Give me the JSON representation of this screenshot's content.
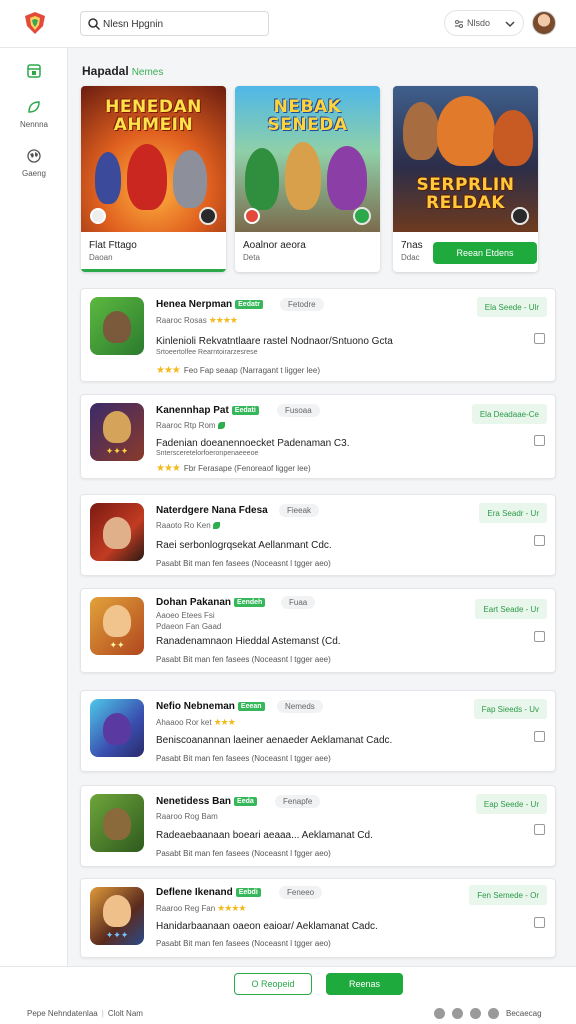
{
  "header": {
    "search_placeholder": "Nlesn Hpgnin",
    "pill_label": "Nlsdo"
  },
  "sidebar": {
    "items": [
      {
        "label": ""
      },
      {
        "label": "Nennna"
      },
      {
        "label": "Gaeng"
      }
    ]
  },
  "section": {
    "title": "Hapadal",
    "accent": "Nemes"
  },
  "featured": [
    {
      "art_title": "HENEDAN\nAHMEIN",
      "name": "Flat Fttago",
      "sub": "Daoan"
    },
    {
      "art_title": "NEBAK\nSENEDA",
      "name": "Aoalnor aeora",
      "sub": "Deta"
    },
    {
      "art_title": "SERPRLIN\nRELDAK",
      "name": "7nas",
      "sub": "Ddac",
      "button": "Reean Etdens"
    }
  ],
  "rows": [
    {
      "name": "Henea Nerpman",
      "tag": "Eedatr",
      "chip": "Fetodre",
      "meta": "Raaroc Rosas",
      "stars_meta": "★★★★",
      "desc": "Kinlenioli Rekvatntlaare rastel Nodnaor/Sntuono Gcta",
      "small": "Srtoeertolfee Rearntoirarzesrese",
      "foot_stars": "★★★",
      "foot": "Feo   Fap seaap   (Narragant t ligger lee)",
      "action": "Ela Seede -   Ulr"
    },
    {
      "name": "Kanennhap Pat",
      "tag": "Eedati",
      "chip": "Fusoaa",
      "meta": "Raaroc Rtp Rom",
      "stars_meta": "",
      "desc": "Fadenian doeanennoecket Padenaman C3.",
      "small": "Sntersceretelorfoeronpenaeeeoe",
      "foot_stars": "★★★",
      "foot": "Fbr   Ferasape   (Fenoreaof ligger lee)",
      "action": "Ela Deadaae-Ce"
    },
    {
      "name": "Naterdgere Nana Fdesa",
      "tag": "",
      "chip": "Fieeak",
      "meta": "Raaoto Ro Ken",
      "stars_meta": "",
      "desc": "Raei serbonlogrqsekat Aellanmant Cdc.",
      "small": "",
      "foot_stars": "",
      "foot": "Pasabt   Bit man fen fasees   (Noceasnt l tgger aeo)",
      "action": "Era Seadr -   Ur"
    },
    {
      "name": "Dohan Pakanan",
      "tag": "Eendeh",
      "chip": "Fuaa",
      "meta": "Aaoeo Etees   Fsi",
      "stars_meta": "",
      "desc": "Ranadenamnaon Hieddal Astemanst (Cd.",
      "small": "Pdaeon Fan Gaad",
      "foot_stars": "",
      "foot": "Pasabt   Bit man fen fasees   (Noceasnt l tgger aee)",
      "action": "Eart Seade - Ur"
    },
    {
      "name": "Nefio Nebneman",
      "tag": "Eeean",
      "chip": "Nemeds",
      "meta": "Ahaaoo Ror ket",
      "stars_meta": "★★★",
      "desc": "Beniscoanannan laeiner aenaeder Aeklamanat Cadc.",
      "small": "",
      "foot_stars": "",
      "foot": "Pasabt   Bit man fen fasees   (Noceasnt l tgger aee)",
      "action": "Fap Sieeds -   Uv"
    },
    {
      "name": "Nenetidess Ban",
      "tag": "Eeda",
      "chip": "Fenapfe",
      "meta": "Raaroo Rog Bam",
      "stars_meta": "",
      "desc": "Radeaebaanaan boeari aeaaa... Aeklamanat Cd.",
      "small": "",
      "foot_stars": "",
      "foot": "Pasabt   Bit man fen fasees   (Noceasnt l fgger aeo)",
      "action": "Eap Seede -   Ur"
    },
    {
      "name": "Deflene Ikenand",
      "tag": "Eebdi",
      "chip": "Feneeo",
      "meta": "Raaroo Reg Fan",
      "stars_meta": "★★★★",
      "desc": "Hanidarbaanaan oaeon eaioar/ Aeklamanat Cadc.",
      "small": "",
      "foot_stars": "",
      "foot": "Pasabt   Bit man fen fasees   (Noceasnt l tgger aeo)",
      "action": "Fen Semede -   Or"
    }
  ],
  "footer": {
    "outline_button": "O Reopeid",
    "solid_button": "Reenas",
    "links": [
      "Pepe Nehndatenlaa",
      "Clolt Nam"
    ],
    "right_label": "Becaecag"
  }
}
